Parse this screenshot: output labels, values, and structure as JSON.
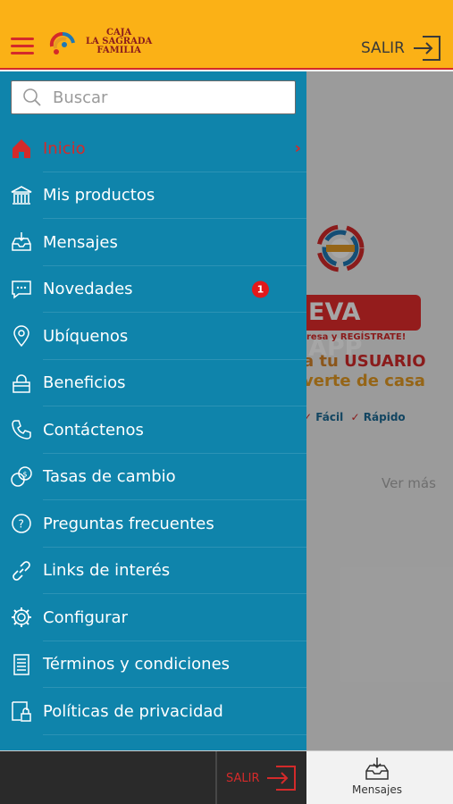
{
  "header": {
    "logo_line1": "CAJA",
    "logo_line2": "LA SAGRADA",
    "logo_line3": "FAMILIA",
    "logout_label": "SALIR"
  },
  "search": {
    "placeholder": "Buscar"
  },
  "menu": {
    "items": [
      {
        "label": "Inicio",
        "icon": "home-icon",
        "active": true
      },
      {
        "label": "Mis productos",
        "icon": "bank-icon"
      },
      {
        "label": "Mensajes",
        "icon": "inbox-icon"
      },
      {
        "label": "Novedades",
        "icon": "chat-icon",
        "badge": "1"
      },
      {
        "label": "Ubíquenos",
        "icon": "location-pin-icon"
      },
      {
        "label": "Beneficios",
        "icon": "bag-icon"
      },
      {
        "label": "Contáctenos",
        "icon": "phone-icon"
      },
      {
        "label": "Tasas de cambio",
        "icon": "currency-exchange-icon"
      },
      {
        "label": "Preguntas frecuentes",
        "icon": "question-icon"
      },
      {
        "label": "Links de interés",
        "icon": "link-icon"
      },
      {
        "label": "Configurar",
        "icon": "gear-icon"
      },
      {
        "label": "Términos y condiciones",
        "icon": "document-icon"
      },
      {
        "label": "Políticas de privacidad",
        "icon": "privacy-lock-icon"
      }
    ]
  },
  "background": {
    "banner_text": "EVA APP",
    "small_text": "resa y REGÍSTRATE!",
    "usuario_line_prefix": "a tu",
    "usuario_line_highlight": "USUARIO",
    "casa_line": "verte de casa",
    "check_facil": "Fácil",
    "check_rapido": "Rápido",
    "ver_mas": "Ver más"
  },
  "bottom_bar": {
    "logout_label": "SALIR",
    "mensajes_label": "Mensajes"
  },
  "colors": {
    "header_bg": "#fbb116",
    "drawer_bg": "#0f84ab",
    "accent_red": "#d42a2a",
    "badge_red": "#e3181b"
  }
}
